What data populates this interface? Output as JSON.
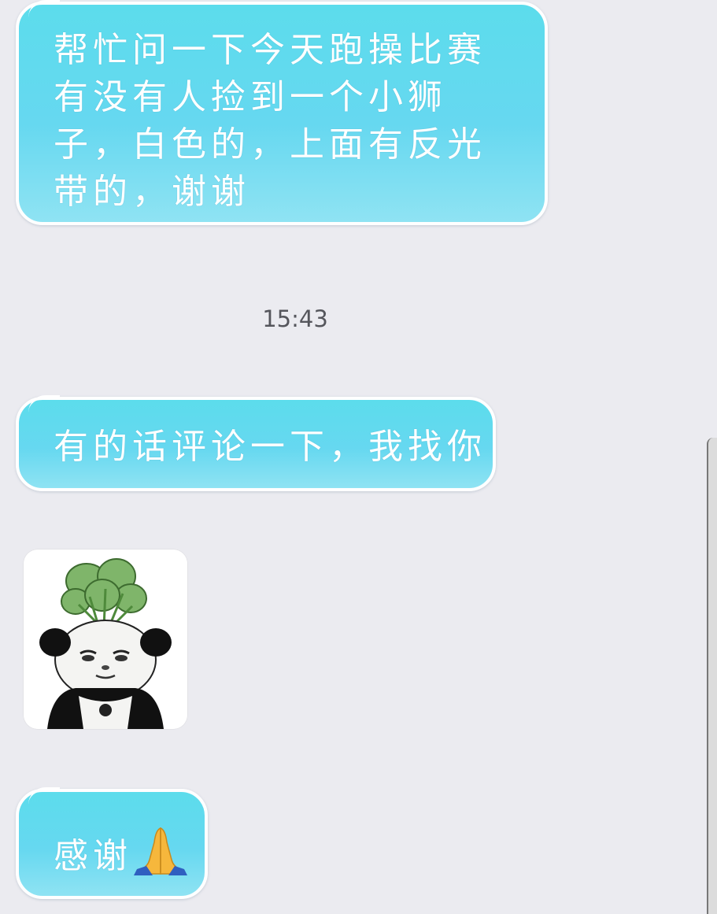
{
  "chat": {
    "messages": [
      {
        "text": "帮忙问一下今天跑操比赛有没有人捡到一个小狮子，白色的，上面有反光带的，谢谢"
      },
      {
        "text": "有的话评论一下，我找你"
      },
      {
        "sticker": "panda-radish-sticker"
      },
      {
        "text": "感谢"
      }
    ],
    "timestamp": "15:43",
    "thanks_emoji": "folded-hands-emoji"
  },
  "colors": {
    "bubble": "#66d8f0",
    "bubble_border": "#ffffff",
    "background": "#ebebf0",
    "timestamp": "#55565c"
  }
}
